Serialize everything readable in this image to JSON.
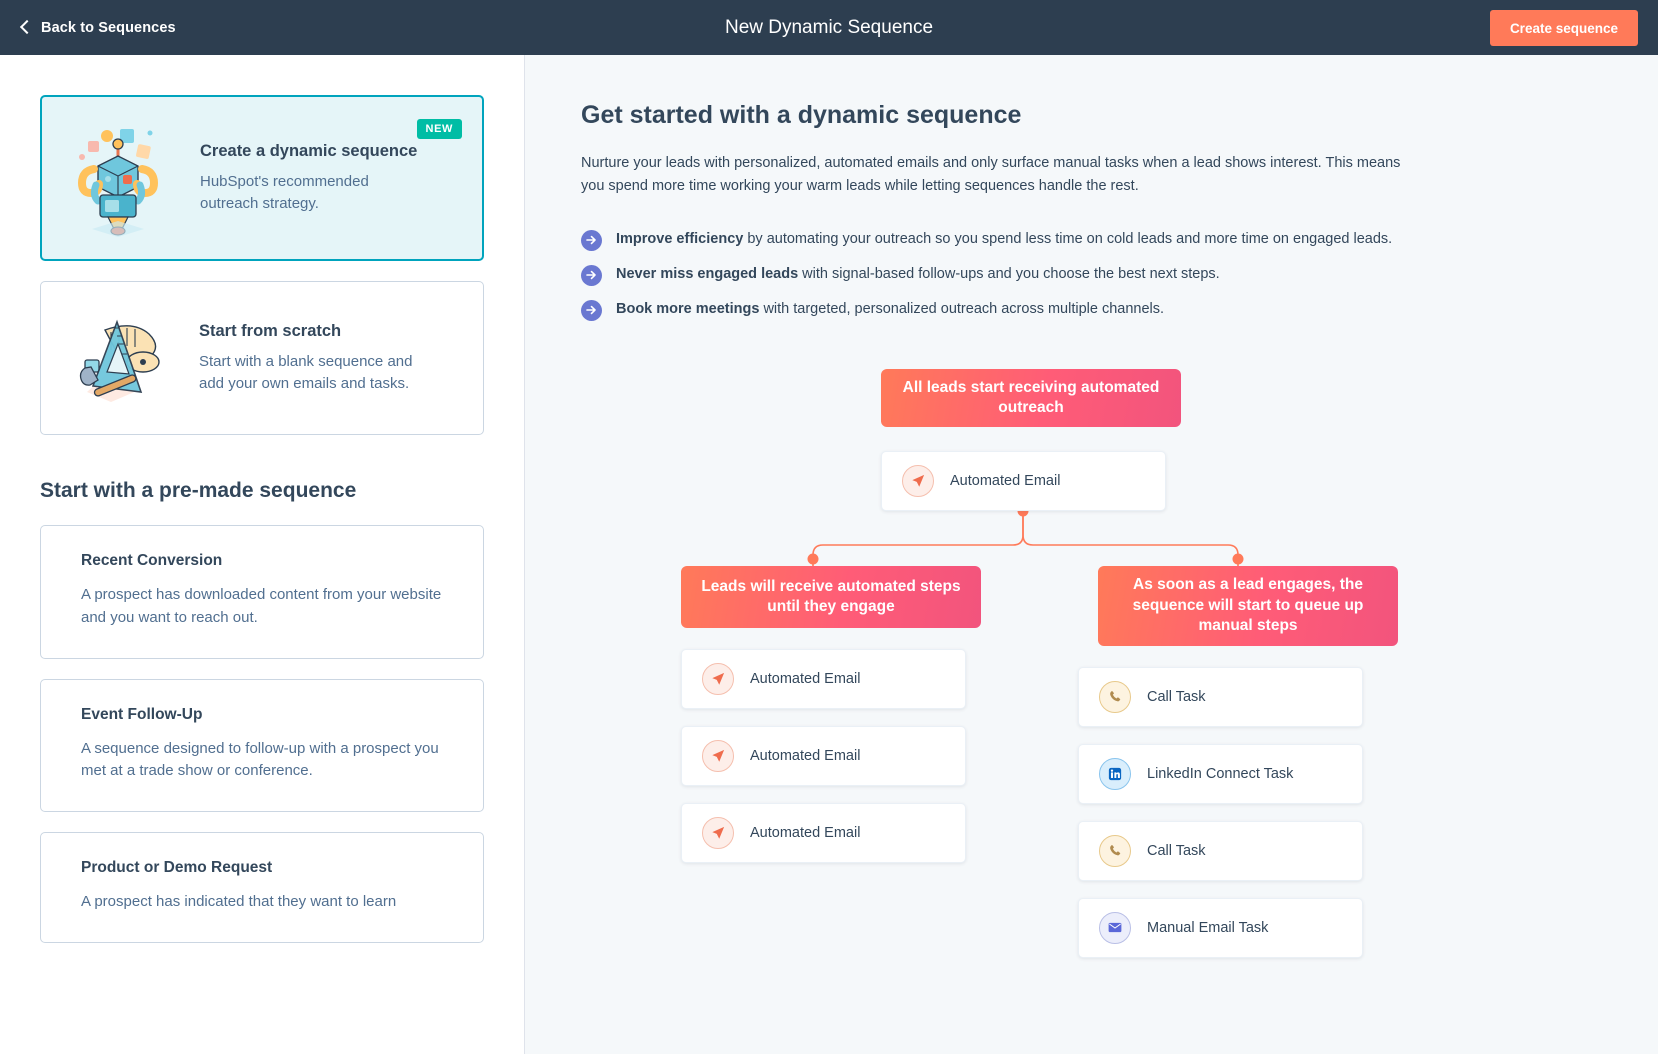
{
  "topbar": {
    "back_label": "Back to Sequences",
    "title": "New Dynamic Sequence",
    "create_label": "Create sequence",
    "background": "#2d3e50",
    "accent": "#ff7a59"
  },
  "sidebar": {
    "options": [
      {
        "title": "Create a dynamic sequence",
        "desc": "HubSpot's recommended outreach strategy.",
        "badge": "NEW",
        "selected": true,
        "illustration": "robot-illustration"
      },
      {
        "title": "Start from scratch",
        "desc": "Start with a blank sequence and add your own emails and tasks.",
        "badge": "",
        "selected": false,
        "illustration": "ruler-hammer-illustration"
      }
    ],
    "premade_heading": "Start with a pre-made sequence",
    "premade": [
      {
        "title": "Recent Conversion",
        "desc": "A prospect has downloaded content from your website and you want to reach out."
      },
      {
        "title": "Event Follow-Up",
        "desc": "A sequence designed to follow-up with a prospect you met at a trade show or conference."
      },
      {
        "title": "Product or Demo Request",
        "desc": "A prospect has indicated that they want to learn"
      }
    ]
  },
  "main": {
    "title": "Get started with a dynamic sequence",
    "description": "Nurture your leads with personalized, automated emails and only surface manual tasks when a lead shows interest. This means you spend more time working your warm leads while letting sequences handle the rest.",
    "bullets": [
      {
        "bold": "Improve efficiency",
        "rest": " by automating your outreach so you spend less time on cold leads and more time on engaged leads."
      },
      {
        "bold": "Never miss engaged leads",
        "rest": " with signal-based follow-ups and you choose the best next steps."
      },
      {
        "bold": "Book more meetings",
        "rest": " with targeted, personalized outreach across multiple channels."
      }
    ],
    "bullet_icon_color": "#6a78d1"
  },
  "diagram": {
    "root_banner": "All leads start receiving automated outreach",
    "root_step": {
      "label": "Automated Email",
      "icon": "paper-plane-icon"
    },
    "left_banner": "Leads will receive automated steps until they engage",
    "right_banner": "As soon as a lead engages, the sequence will start to queue up manual steps",
    "left_steps": [
      {
        "label": "Automated Email",
        "icon": "paper-plane-icon"
      },
      {
        "label": "Automated Email",
        "icon": "paper-plane-icon"
      },
      {
        "label": "Automated Email",
        "icon": "paper-plane-icon"
      }
    ],
    "right_steps": [
      {
        "label": "Call Task",
        "icon": "phone-icon"
      },
      {
        "label": "LinkedIn Connect Task",
        "icon": "linkedin-icon"
      },
      {
        "label": "Call Task",
        "icon": "phone-icon"
      },
      {
        "label": "Manual Email Task",
        "icon": "envelope-icon"
      }
    ],
    "connector_color": "#ff7a59",
    "banner_gradient_from": "#ff7a59",
    "banner_gradient_to": "#f2547d"
  }
}
